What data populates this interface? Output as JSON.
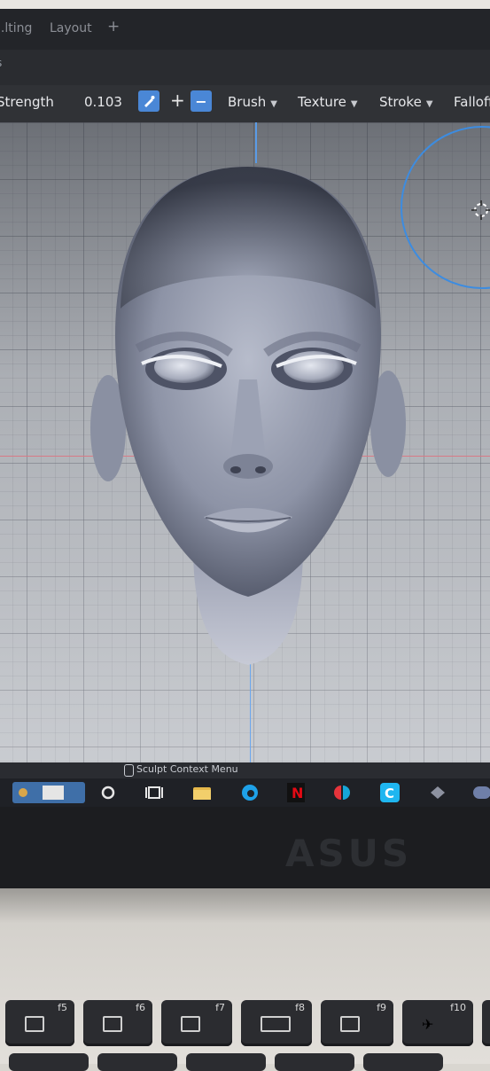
{
  "tabs": {
    "sculpting": "...lting",
    "layout": "Layout",
    "add": "+"
  },
  "toolbar": {
    "strength_label": "Strength",
    "strength_value": "0.103",
    "plus": "+",
    "minus": "−",
    "brush": "Brush",
    "texture": "Texture",
    "stroke": "Stroke",
    "falloff": "Falloff"
  },
  "status": {
    "context_menu": "Sculpt Context Menu"
  },
  "bezel": {
    "brand": "ASUS"
  },
  "keys": [
    "f5",
    "f6",
    "f7",
    "f8",
    "f9",
    "f10"
  ],
  "colors": {
    "accent": "#4a87d6",
    "x_axis": "#d87a86",
    "z_axis": "#5a9be6"
  },
  "taskbar_icons": [
    "thumbnail-icon",
    "search-circle-icon",
    "task-view-icon",
    "folder-icon",
    "edge-icon",
    "netflix-icon",
    "switch-icon",
    "c-app-icon",
    "diamond-icon",
    "chat-icon"
  ]
}
